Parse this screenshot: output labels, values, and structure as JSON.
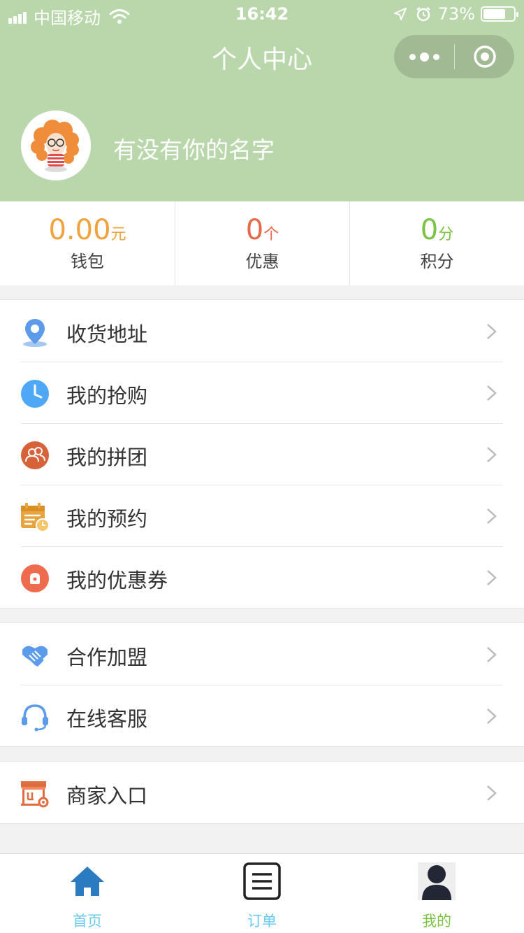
{
  "status_bar": {
    "carrier": "中国移动",
    "time": "16:42",
    "battery": "73%",
    "battery_level": 0.73
  },
  "nav": {
    "title": "个人中心"
  },
  "profile": {
    "username": "有没有你的名字"
  },
  "stats": [
    {
      "value": "0.00",
      "unit": "元",
      "label": "钱包",
      "color": "#f0a23c"
    },
    {
      "value": "0",
      "unit": "个",
      "label": "优惠",
      "color": "#e8684a"
    },
    {
      "value": "0",
      "unit": "分",
      "label": "积分",
      "color": "#7cc245"
    }
  ],
  "menu": {
    "group1": [
      {
        "label": "收货地址",
        "icon": "location-pin-icon",
        "color": "#5b9bea"
      },
      {
        "label": "我的抢购",
        "icon": "clock-icon",
        "color": "#4ea8f5"
      },
      {
        "label": "我的拼团",
        "icon": "group-users-icon",
        "color": "#d7623a"
      },
      {
        "label": "我的预约",
        "icon": "calendar-icon",
        "color": "#e7a33e"
      },
      {
        "label": "我的优惠券",
        "icon": "coupon-icon",
        "color": "#ee6b4d"
      }
    ],
    "group2": [
      {
        "label": "合作加盟",
        "icon": "handshake-icon",
        "color": "#5b9bea"
      },
      {
        "label": "在线客服",
        "icon": "headset-icon",
        "color": "#5b9bea"
      }
    ],
    "group3": [
      {
        "label": "商家入口",
        "icon": "storefront-icon",
        "color": "#e06d40"
      }
    ]
  },
  "tabbar": [
    {
      "label": "首页",
      "icon": "home-icon",
      "color": "#6ac9ee"
    },
    {
      "label": "订单",
      "icon": "order-list-icon",
      "color": "#6ac9ee"
    },
    {
      "label": "我的",
      "icon": "user-icon",
      "color": "#7cc245"
    }
  ]
}
